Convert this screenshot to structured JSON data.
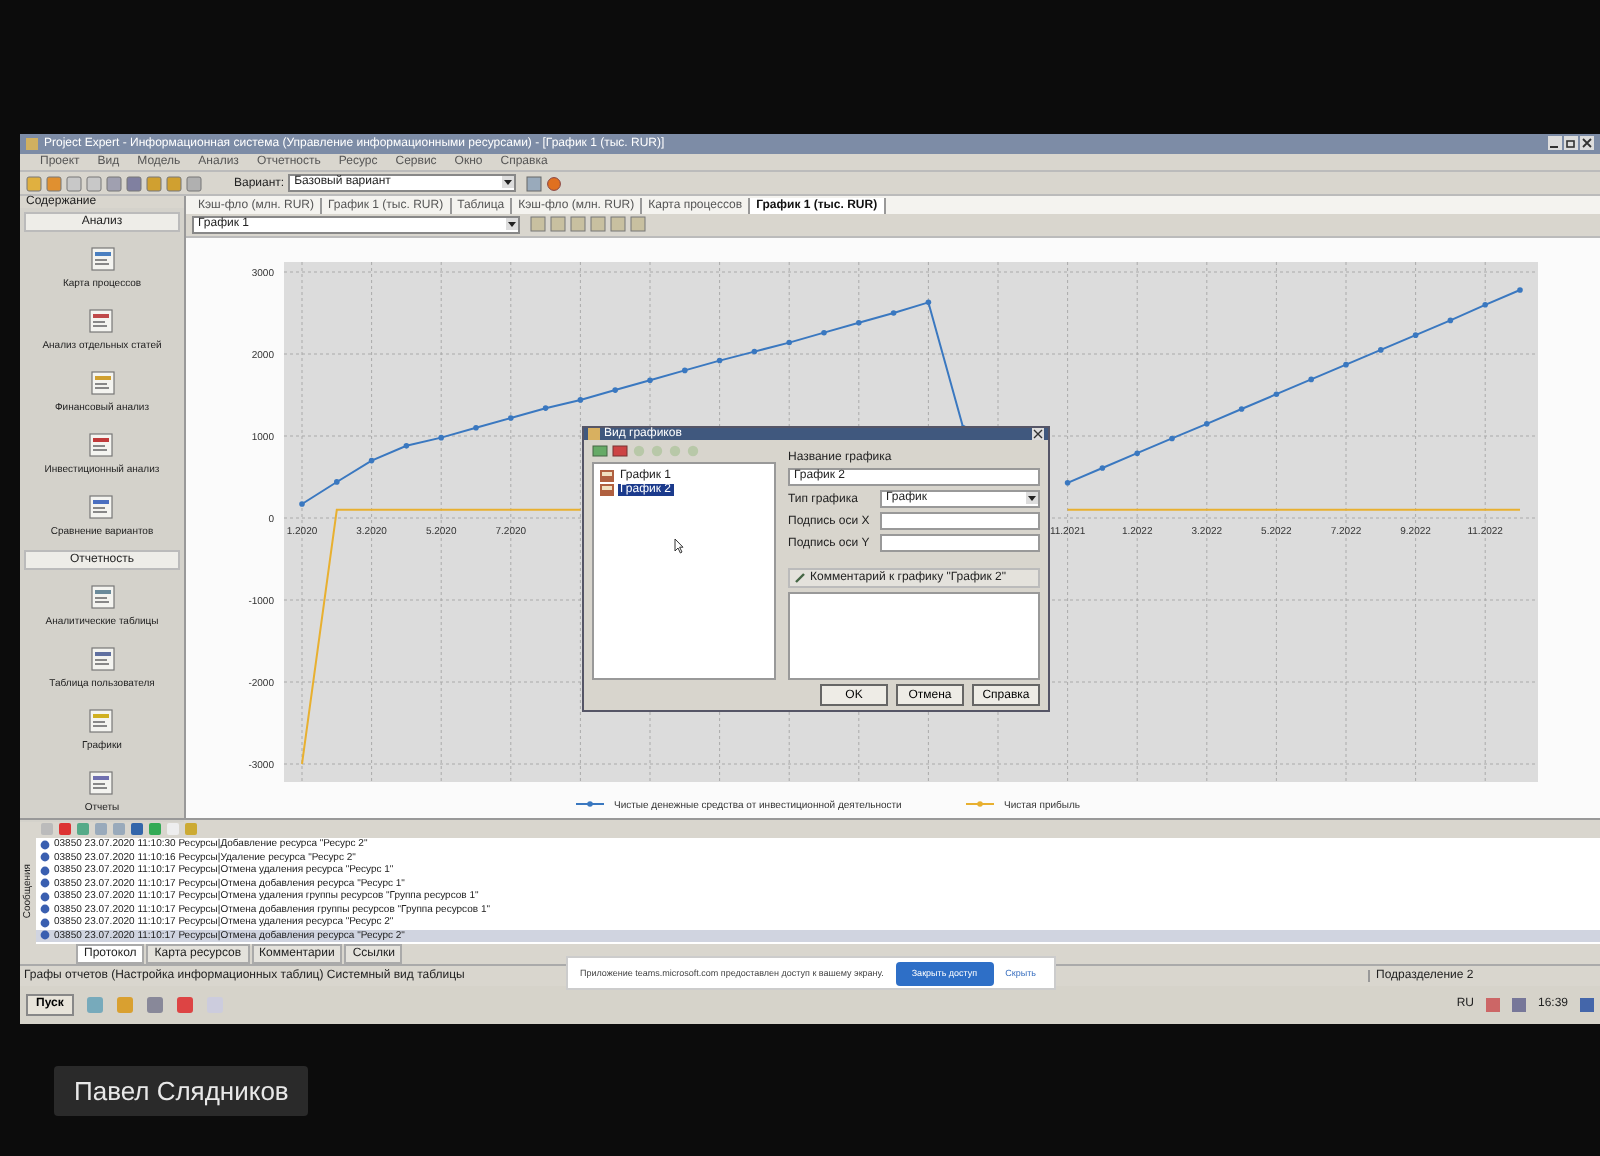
{
  "window": {
    "title": "Project Expert - Информационная система (Управление информационными ресурсами) - [График 1 (тыс. RUR)]"
  },
  "menu": [
    "Проект",
    "Вид",
    "Модель",
    "Анализ",
    "Отчетность",
    "Ресурс",
    "Сервис",
    "Окно",
    "Справка"
  ],
  "toolbar": {
    "variant_label": "Вариант:",
    "variant": "Базовый вариант"
  },
  "sidebar": {
    "title": "Содержание",
    "items": [
      {
        "kind": "section",
        "label": "Анализ"
      },
      {
        "kind": "item",
        "label": "Карта процессов"
      },
      {
        "kind": "item",
        "label": "Анализ отдельных статей"
      },
      {
        "kind": "item",
        "label": "Финансовый анализ"
      },
      {
        "kind": "item",
        "label": "Инвестиционный анализ"
      },
      {
        "kind": "item",
        "label": "Сравнение вариантов"
      },
      {
        "kind": "section",
        "label": "Отчетность"
      },
      {
        "kind": "item",
        "label": "Аналитические таблицы"
      },
      {
        "kind": "item",
        "label": "Таблица пользователя"
      },
      {
        "kind": "item",
        "label": "Графики"
      },
      {
        "kind": "item",
        "label": "Отчеты"
      }
    ]
  },
  "tabs": [
    {
      "label": "Кэш-фло (млн. RUR)",
      "selected": false
    },
    {
      "label": "График 1 (тыс. RUR)",
      "selected": false
    },
    {
      "label": "Таблица",
      "selected": false
    },
    {
      "label": "Кэш-фло (млн. RUR)",
      "selected": false
    },
    {
      "label": "Карта процессов",
      "selected": false
    },
    {
      "label": "График 1 (тыс. RUR)",
      "selected": true
    }
  ],
  "chart_select": "График 1",
  "chart": {
    "chart_data": {
      "type": "line",
      "ylim": [
        -3000,
        3000
      ],
      "grid": true,
      "legend": true,
      "yticks": [
        -3000,
        -2000,
        -1000,
        0,
        1000,
        2000,
        3000
      ],
      "categories": [
        "1.2020",
        null,
        "3.2020",
        null,
        "5.2020",
        null,
        "7.2020",
        null,
        null,
        null,
        null,
        null,
        null,
        null,
        null,
        null,
        null,
        null,
        null,
        null,
        null,
        null,
        "11.2021",
        null,
        "1.2022",
        null,
        "3.2022",
        null,
        "5.2022",
        null,
        "7.2022",
        null,
        "9.2022",
        null,
        "11.2022",
        null
      ],
      "series": [
        {
          "name": "Чистые денежные средства от инвестиционной деятельности",
          "color": "#3a78c0",
          "values": [
            170,
            440,
            700,
            880,
            980,
            1100,
            1220,
            1340,
            1440,
            1560,
            1680,
            1800,
            1920,
            2030,
            2140,
            2260,
            2380,
            2500,
            2630,
            1100,
            null,
            null,
            430,
            610,
            790,
            970,
            1150,
            1330,
            1510,
            1690,
            1870,
            2050,
            2230,
            2410,
            2600,
            2780
          ]
        },
        {
          "name": "Чистая прибыль",
          "color": "#e8b030",
          "values": [
            -3000,
            100,
            100,
            100,
            100,
            100,
            100,
            100,
            100,
            null,
            null,
            null,
            null,
            null,
            null,
            null,
            null,
            null,
            null,
            null,
            null,
            null,
            100,
            100,
            100,
            100,
            100,
            100,
            100,
            100,
            100,
            100,
            100,
            100,
            100,
            100
          ]
        }
      ]
    }
  },
  "dialog": {
    "title": "Вид графиков",
    "tree": [
      {
        "label": "График 1",
        "selected": false
      },
      {
        "label": "График 2",
        "selected": true
      }
    ],
    "fields": [
      {
        "kind": "stacked",
        "label": "Название графика",
        "value": "График 2"
      },
      {
        "kind": "select",
        "label": "Тип графика",
        "value": "График"
      },
      {
        "kind": "input",
        "label": "Подпись оси X"
      },
      {
        "kind": "input",
        "label": "Подпись оси Y"
      }
    ],
    "comment_label": "Комментарий к графику \"График 2\"",
    "buttons": [
      "OK",
      "Отмена",
      "Справка"
    ]
  },
  "log": {
    "side_label": "Сообщения",
    "rows": [
      {
        "text": "03850 23.07.2020 11:10:30 Ресурсы|Добавление ресурса \"Ресурс 2\"",
        "selected": false
      },
      {
        "text": "03850 23.07.2020 11:10:16 Ресурсы|Удаление ресурса \"Ресурс 2\"",
        "selected": false
      },
      {
        "text": "03850 23.07.2020 11:10:17 Ресурсы|Отмена удаления ресурса \"Ресурс 1\"",
        "selected": false
      },
      {
        "text": "03850 23.07.2020 11:10:17 Ресурсы|Отмена добавления ресурса \"Ресурс 1\"",
        "selected": false
      },
      {
        "text": "03850 23.07.2020 11:10:17 Ресурсы|Отмена удаления группы ресурсов \"Группа ресурсов 1\"",
        "selected": false
      },
      {
        "text": "03850 23.07.2020 11:10:17 Ресурсы|Отмена добавления группы ресурсов \"Группа ресурсов 1\"",
        "selected": false
      },
      {
        "text": "03850 23.07.2020 11:10:17 Ресурсы|Отмена удаления ресурса \"Ресурс 2\"",
        "selected": false
      },
      {
        "text": "03850 23.07.2020 11:10:17 Ресурсы|Отмена добавления ресурса \"Ресурс 2\"",
        "selected": true
      }
    ],
    "tabs": [
      {
        "label": "Протокол",
        "selected": true
      },
      {
        "label": "Карта ресурсов",
        "selected": false
      },
      {
        "label": "Комментарии",
        "selected": false
      },
      {
        "label": "Ссылки",
        "selected": false
      }
    ]
  },
  "status_bar": {
    "text": "Графы отчетов (Настройка информационных таблиц) Системный вид таблицы",
    "right": "Подразделение 2"
  },
  "taskbar": {
    "start": "Пуск",
    "lang": "RU",
    "clock": "16:39"
  },
  "share_notice": {
    "text": "Приложение teams.microsoft.com предоставлен доступ к вашему экрану.",
    "stop": "Закрыть доступ",
    "hide": "Скрыть"
  },
  "caption": "Павел Слядников"
}
